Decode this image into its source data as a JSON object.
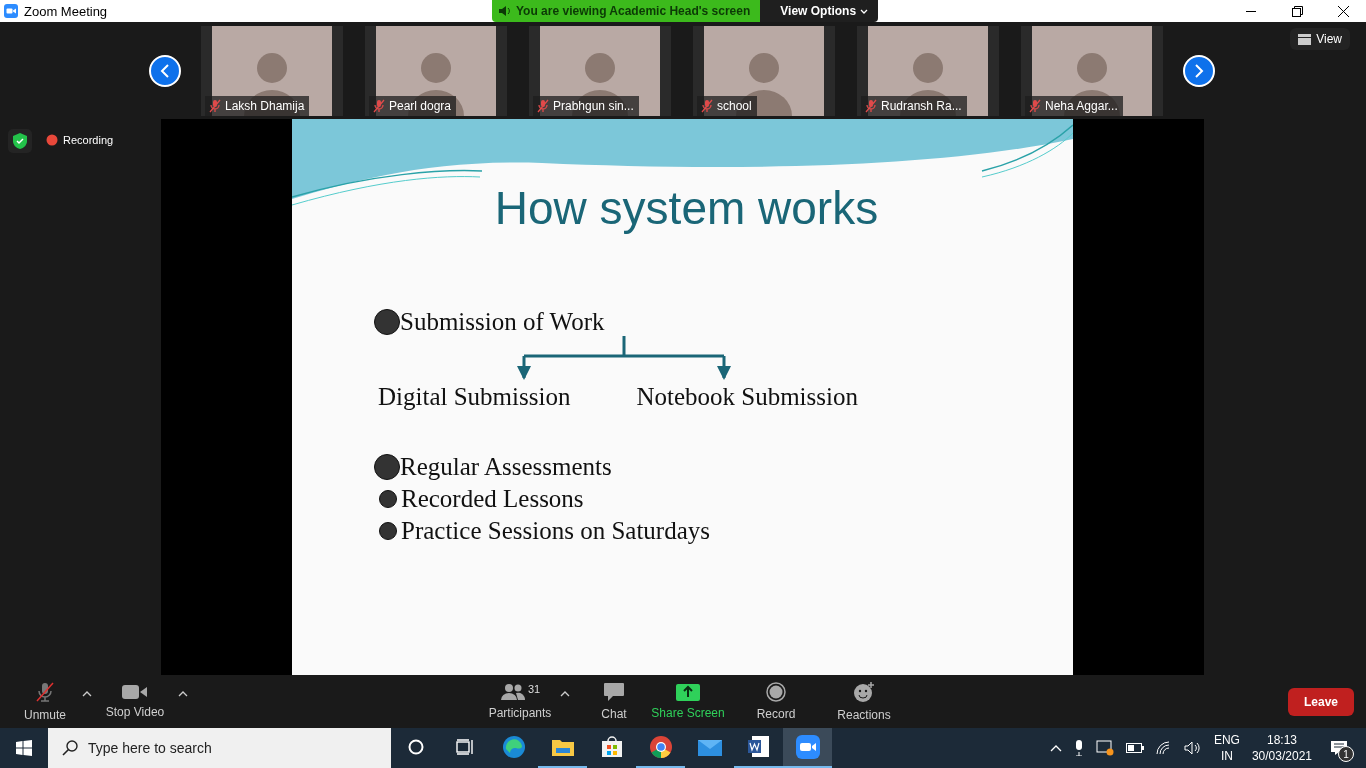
{
  "window": {
    "title": "Zoom Meeting"
  },
  "banner": {
    "text": "You are viewing Academic Head's screen",
    "options_label": "View Options"
  },
  "participants": [
    {
      "name": "Laksh Dhamija",
      "muted": true
    },
    {
      "name": "Pearl dogra",
      "muted": true
    },
    {
      "name": "Prabhgun sin...",
      "muted": true
    },
    {
      "name": "school",
      "muted": true
    },
    {
      "name": "Rudransh Ra...",
      "muted": true
    },
    {
      "name": "Neha Aggar...",
      "muted": true
    }
  ],
  "view_button": "View",
  "recording": "Recording",
  "slide": {
    "title": "How system works",
    "root": "Submission of Work",
    "branches": [
      "Digital Submission",
      "Notebook Submission"
    ],
    "points": [
      {
        "text": "Regular Assessments",
        "kind": "large"
      },
      {
        "text": "Recorded Lessons",
        "kind": "small"
      },
      {
        "text": "Practice Sessions on Saturdays",
        "kind": "small"
      }
    ]
  },
  "toolbar": {
    "left": [
      {
        "kind": "mic",
        "label": "Unmute",
        "muted": true
      },
      {
        "kind": "video",
        "label": "Stop Video",
        "muted": false
      }
    ],
    "center": [
      {
        "kind": "participants",
        "label": "Participants",
        "count": "31",
        "accent": false
      },
      {
        "kind": "chat",
        "label": "Chat",
        "accent": false
      },
      {
        "kind": "share",
        "label": "Share Screen",
        "accent": true
      },
      {
        "kind": "record",
        "label": "Record",
        "accent": false
      },
      {
        "kind": "reactions",
        "label": "Reactions",
        "accent": false
      }
    ],
    "leave": "Leave"
  },
  "taskbar": {
    "search_placeholder": "Type here to search",
    "apps": [
      {
        "kind": "cortana",
        "running": false,
        "selected": false
      },
      {
        "kind": "taskview",
        "running": false,
        "selected": false
      },
      {
        "kind": "edge",
        "running": false,
        "selected": false
      },
      {
        "kind": "explorer",
        "running": true,
        "selected": false
      },
      {
        "kind": "store",
        "running": false,
        "selected": false
      },
      {
        "kind": "chrome",
        "running": true,
        "selected": false
      },
      {
        "kind": "mail",
        "running": false,
        "selected": false
      },
      {
        "kind": "word",
        "running": true,
        "selected": false
      },
      {
        "kind": "zoom",
        "running": true,
        "selected": true
      }
    ],
    "language": [
      "ENG",
      "IN"
    ],
    "time": "18:13",
    "date": "30/03/2021",
    "notifications": "1"
  }
}
